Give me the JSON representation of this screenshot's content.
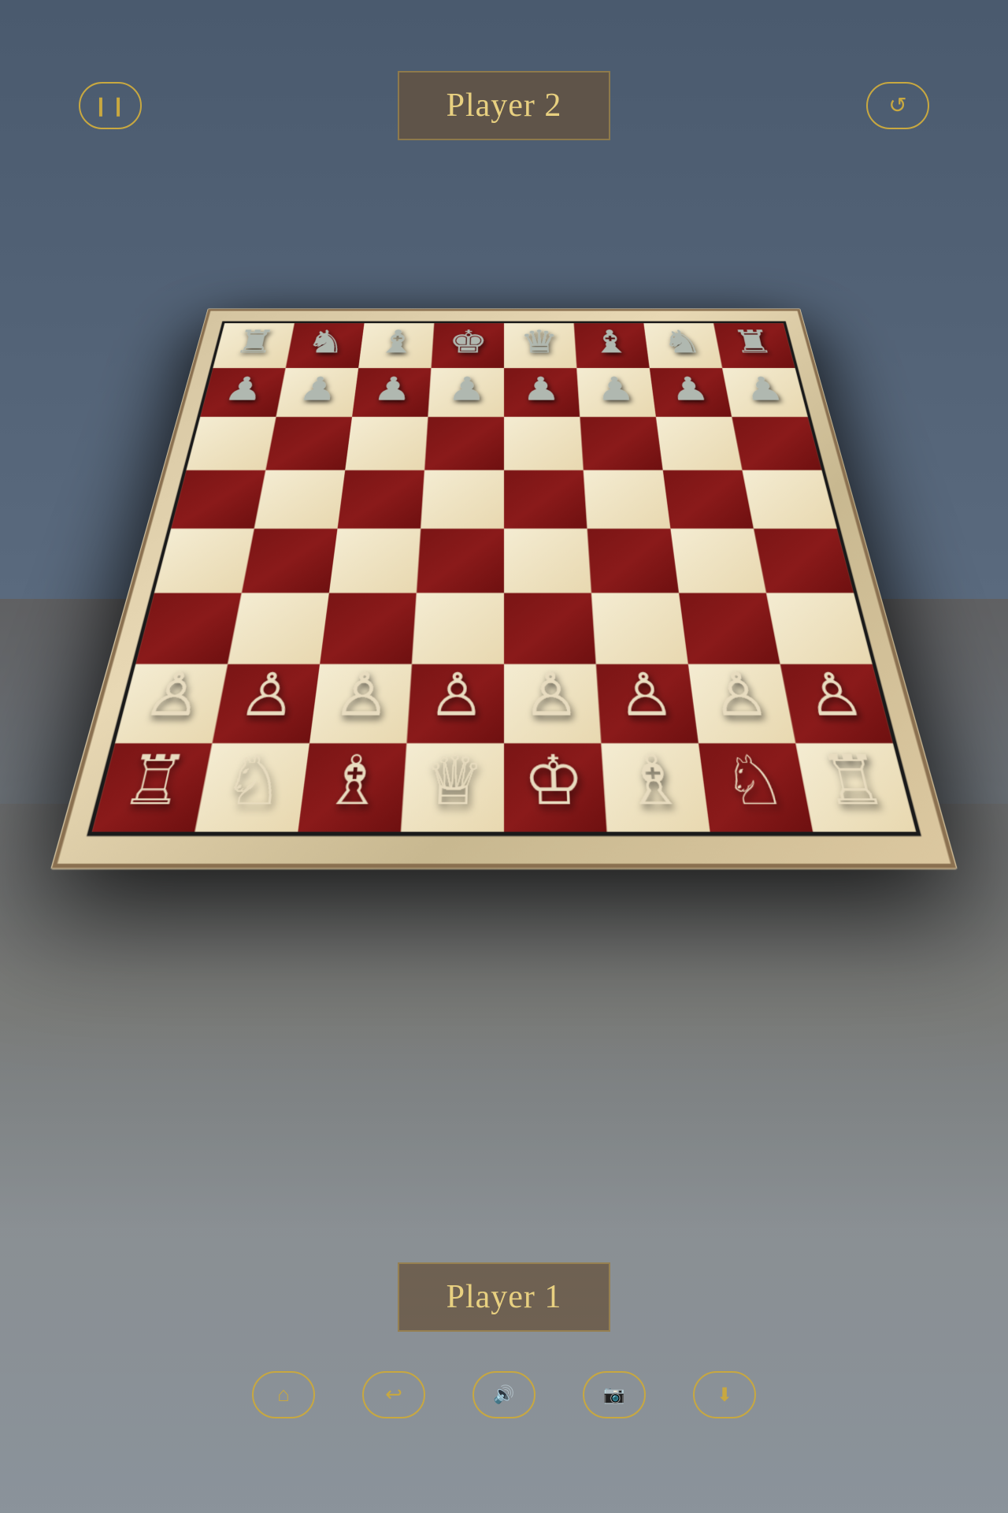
{
  "header": {
    "player2_label": "Player 2",
    "player1_label": "Player 1",
    "pause_btn": "⏸",
    "restart_btn": "↺"
  },
  "controls": {
    "home_label": "Home",
    "undo_label": "Undo",
    "sound_label": "Sound",
    "camera_label": "Camera",
    "download_label": "Download"
  },
  "board": {
    "rows": 8,
    "cols": 8
  },
  "colors": {
    "dark_square": "#7a1515",
    "light_square": "#f0e4c8",
    "gold_accent": "#c8a840",
    "player_bg": "rgba(101,82,60,0.75)"
  }
}
